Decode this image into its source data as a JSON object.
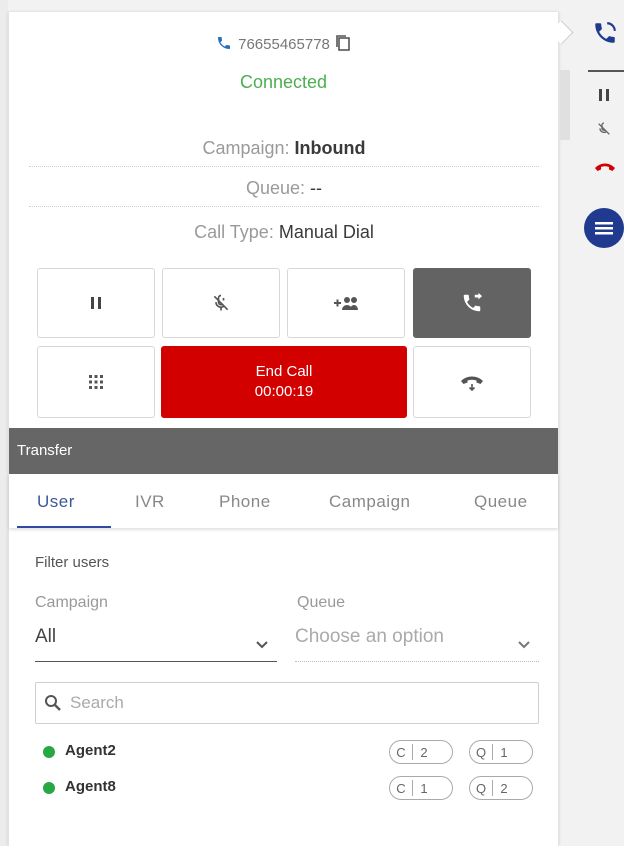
{
  "call": {
    "phone_number": "76655465778",
    "status": "Connected",
    "campaign_label": "Campaign:",
    "campaign_value": "Inbound",
    "queue_label": "Queue:",
    "queue_value": "--",
    "call_type_label": "Call Type:",
    "call_type_value": "Manual Dial"
  },
  "controls": {
    "buttons": [
      {
        "name": "hold-button",
        "icon": "pause-icon"
      },
      {
        "name": "mute-button",
        "icon": "mic-off-icon"
      },
      {
        "name": "conference-button",
        "icon": "add-group-icon"
      },
      {
        "name": "transfer-button",
        "icon": "phone-forward-icon",
        "active": true
      },
      {
        "name": "dialpad-button",
        "icon": "dialpad-icon"
      },
      {
        "name": "hangup-alt-button",
        "icon": "phone-hangup-icon"
      }
    ],
    "end_call_label": "End Call",
    "timer": "00:00:19",
    "colors": {
      "end_call": "#d30000",
      "active": "#636363",
      "connected": "#4caf50",
      "accent": "#2f4aa0"
    }
  },
  "transfer": {
    "title": "Transfer",
    "tabs": [
      "User",
      "IVR",
      "Phone",
      "Campaign",
      "Queue"
    ],
    "active_tab": "User",
    "filter_label": "Filter users",
    "campaign_field_label": "Campaign",
    "campaign_selected": "All",
    "queue_field_label": "Queue",
    "queue_placeholder": "Choose an option",
    "search_placeholder": "Search",
    "agents": [
      {
        "name": "Agent2",
        "status": "online",
        "c_label": "C",
        "c_count": "2",
        "q_label": "Q",
        "q_count": "1"
      },
      {
        "name": "Agent8",
        "status": "online",
        "c_label": "C",
        "c_count": "1",
        "q_label": "Q",
        "q_count": "2"
      }
    ]
  },
  "sidebar": {
    "icons": [
      "phone-active-icon",
      "pause-icon",
      "mic-off-icon",
      "hangup-icon",
      "menu-icon"
    ]
  }
}
